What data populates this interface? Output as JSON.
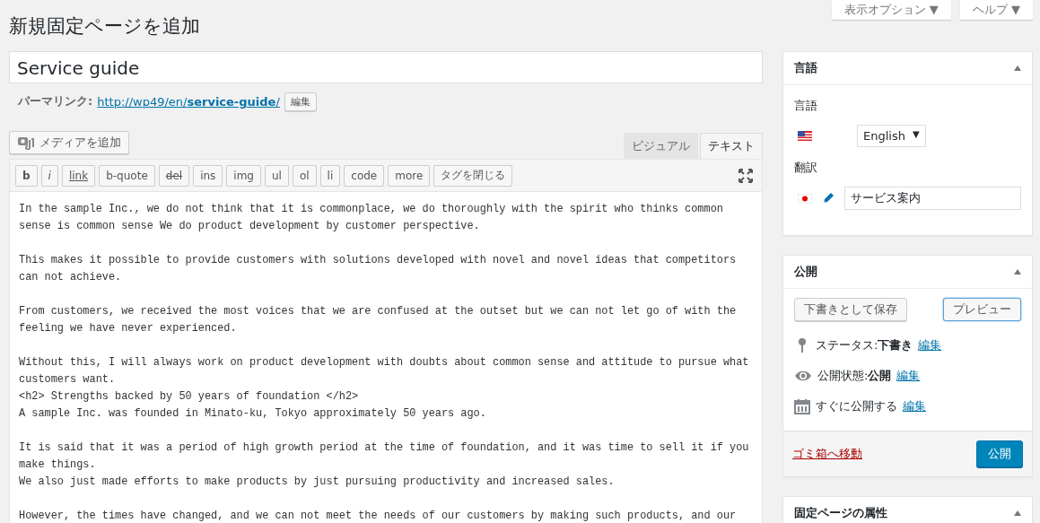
{
  "top_buttons": [
    {
      "label": "表示オプション ▼"
    },
    {
      "label": "ヘルプ ▼"
    }
  ],
  "page_title": "新規固定ページを追加",
  "post_title": {
    "value": "Service guide"
  },
  "permalink": {
    "label": "パーマリンク:",
    "url_prefix": "http://wp49/en/",
    "url_slug": "service-guide",
    "url_suffix": "/",
    "button": "編集"
  },
  "add_media": "メディアを追加",
  "editor_tabs": [
    {
      "label": "ビジュアル",
      "selected": false
    },
    {
      "label": "テキスト",
      "selected": true
    }
  ],
  "quicktags": [
    {
      "label": "b",
      "kind": "bold"
    },
    {
      "label": "i",
      "kind": "italic"
    },
    {
      "label": "link",
      "kind": "underline"
    },
    {
      "label": "b-quote",
      "kind": "plain"
    },
    {
      "label": "del",
      "kind": "strike"
    },
    {
      "label": "ins",
      "kind": "plain"
    },
    {
      "label": "img",
      "kind": "plain"
    },
    {
      "label": "ul",
      "kind": "plain"
    },
    {
      "label": "ol",
      "kind": "plain"
    },
    {
      "label": "li",
      "kind": "plain"
    },
    {
      "label": "code",
      "kind": "plain"
    },
    {
      "label": "more",
      "kind": "plain"
    },
    {
      "label": "タグを閉じる",
      "kind": "plain"
    }
  ],
  "content_paragraphs": [
    [
      "In the sample Inc., we do not think that it is commonplace, we do thoroughly with the spirit who thinks common",
      "sense is common sense We do product development by customer perspective."
    ],
    [
      "This makes it possible to provide customers with solutions developed with novel and novel ideas that competitors",
      "can not achieve."
    ],
    [
      "From customers, we received the most voices that we are confused at the outset but we can not let go of with the",
      "feeling we have never experienced."
    ],
    [
      "Without this, I will always work on product development with doubts about common sense and attitude to pursue what",
      "customers want.",
      "<h2> Strengths backed by 50 years of foundation </h2>",
      "A sample Inc. was founded in Minato-ku, Tokyo approximately 50 years ago."
    ],
    [
      "It is said that it was a period of high growth period at the time of foundation, and it was time to sell it if you",
      "make things.",
      "We also just made efforts to make products by just pursuing productivity and increased sales."
    ],
    [
      "However, the times have changed, and we can not meet the needs of our customers by making such products, and our"
    ]
  ],
  "language_box": {
    "title": "言語",
    "language_label": "言語",
    "language": "English",
    "language_caret": "▼",
    "translation_label": "翻訳",
    "translation": "サービス案内"
  },
  "publish_box": {
    "title": "公開",
    "save_draft": "下書きとして保存",
    "preview": "プレビュー",
    "rows": [
      {
        "kind": "pin",
        "label": "ステータス:",
        "value": "下書き",
        "link": "編集"
      },
      {
        "kind": "eye",
        "label": "公開状態:",
        "value": "公開",
        "link": "編集"
      },
      {
        "kind": "calendar",
        "label": "すぐに公開する",
        "link": "編集"
      }
    ],
    "trash": "ゴミ箱へ移動",
    "publish": "公開"
  },
  "attributes_box": {
    "title": "固定ページの属性"
  }
}
